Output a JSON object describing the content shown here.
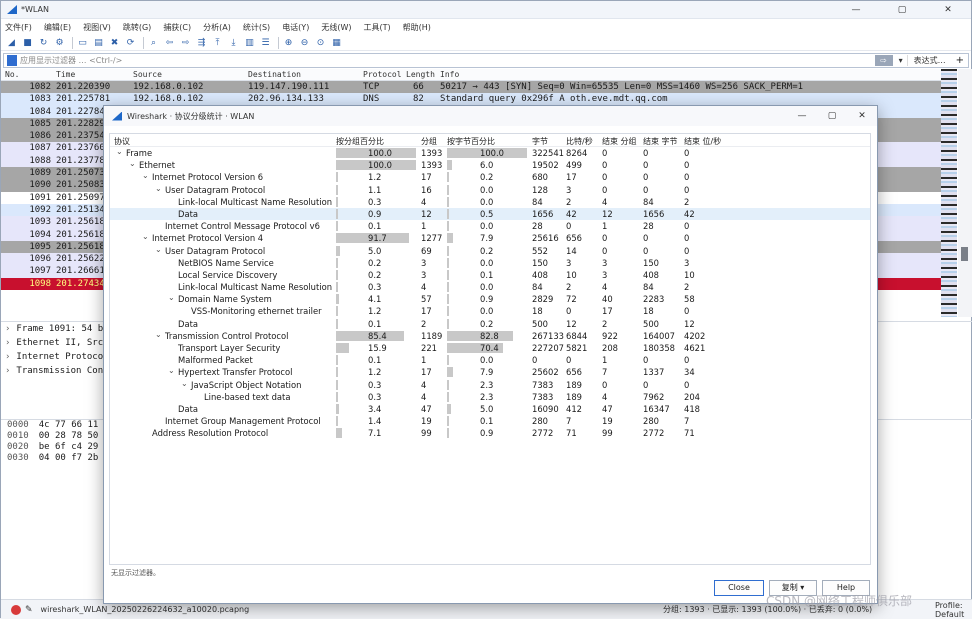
{
  "main": {
    "title": "*WLAN",
    "window_controls": [
      "—",
      "▢",
      "✕"
    ],
    "menu": [
      "文件(F)",
      "编辑(E)",
      "视图(V)",
      "跳转(G)",
      "捕获(C)",
      "分析(A)",
      "统计(S)",
      "电话(Y)",
      "无线(W)",
      "工具(T)",
      "帮助(H)"
    ],
    "filter": {
      "placeholder": "应用显示过滤器 … <Ctrl-/>",
      "arrow": "⇨",
      "dropdown": "▾",
      "expression": "表达式…",
      "plus": "+"
    },
    "columns": [
      "No.",
      "Time",
      "Source",
      "Destination",
      "Protocol",
      "Length",
      "Info"
    ],
    "packets": [
      {
        "no": "1082",
        "time": "201.220390",
        "src": "192.168.0.102",
        "dst": "119.147.190.111",
        "proto": "TCP",
        "len": "66",
        "info": "50217 → 443 [SYN] Seq=0 Win=65535 Len=0 MSS=1460 WS=256 SACK_PERM=1",
        "bg": "#a6a6a6",
        "fg": "#1a1a1a"
      },
      {
        "no": "1083",
        "time": "201.225781",
        "src": "192.168.0.102",
        "dst": "202.96.134.133",
        "proto": "DNS",
        "len": "82",
        "info": "Standard query 0x296f A oth.eve.mdt.qq.com",
        "bg": "#dae8fc",
        "fg": "#1a1a1a"
      },
      {
        "no": "1084",
        "time": "201.22784",
        "src": "",
        "dst": "",
        "proto": "",
        "len": "",
        "info": "",
        "bg": "#dae8fc",
        "fg": "#1a1a1a"
      },
      {
        "no": "1085",
        "time": "201.22829",
        "src": "",
        "dst": "",
        "proto": "",
        "len": "",
        "info": "",
        "bg": "#a6a6a6",
        "fg": "#1a1a1a"
      },
      {
        "no": "1086",
        "time": "201.23754",
        "src": "",
        "dst": "",
        "proto": "",
        "len": "",
        "info": "",
        "bg": "#a6a6a6",
        "fg": "#1a1a1a"
      },
      {
        "no": "1087",
        "time": "201.23760",
        "src": "",
        "dst": "",
        "proto": "",
        "len": "",
        "info": "",
        "bg": "#e6e6fa",
        "fg": "#1a1a1a"
      },
      {
        "no": "1088",
        "time": "201.23778",
        "src": "",
        "dst": "",
        "proto": "",
        "len": "",
        "info": "",
        "bg": "#e6e6fa",
        "fg": "#1a1a1a"
      },
      {
        "no": "1089",
        "time": "201.25073",
        "src": "",
        "dst": "",
        "proto": "",
        "len": "",
        "info": "",
        "bg": "#a6a6a6",
        "fg": "#1a1a1a"
      },
      {
        "no": "1090",
        "time": "201.25083",
        "src": "",
        "dst": "",
        "proto": "",
        "len": "",
        "info": "",
        "bg": "#a6a6a6",
        "fg": "#1a1a1a"
      },
      {
        "no": "1091",
        "time": "201.25097",
        "src": "",
        "dst": "",
        "proto": "",
        "len": "",
        "info": "",
        "bg": "#ffffff",
        "fg": "#1a1a1a"
      },
      {
        "no": "1092",
        "time": "201.25134",
        "src": "",
        "dst": "",
        "proto": "",
        "len": "",
        "info": "",
        "bg": "#dae8fc",
        "fg": "#1a1a1a"
      },
      {
        "no": "1093",
        "time": "201.25618",
        "src": "",
        "dst": "",
        "proto": "",
        "len": "",
        "info": "",
        "bg": "#e6e6fa",
        "fg": "#1a1a1a"
      },
      {
        "no": "1094",
        "time": "201.25618",
        "src": "",
        "dst": "",
        "proto": "",
        "len": "",
        "info": "",
        "bg": "#e6e6fa",
        "fg": "#1a1a1a"
      },
      {
        "no": "1095",
        "time": "201.25618",
        "src": "",
        "dst": "",
        "proto": "",
        "len": "",
        "info": "",
        "bg": "#a6a6a6",
        "fg": "#1a1a1a"
      },
      {
        "no": "1096",
        "time": "201.25622",
        "src": "",
        "dst": "",
        "proto": "",
        "len": "",
        "info": "",
        "bg": "#e6e6fa",
        "fg": "#1a1a1a"
      },
      {
        "no": "1097",
        "time": "201.26661",
        "src": "",
        "dst": "",
        "proto": "",
        "len": "",
        "info": "",
        "bg": "#e6e6fa",
        "fg": "#1a1a1a"
      },
      {
        "no": "1098",
        "time": "201.27434",
        "src": "",
        "dst": "",
        "proto": "",
        "len": "",
        "info": "",
        "bg": "#c8102e",
        "fg": "#ffff80"
      }
    ],
    "details": [
      "Frame 1091: 54 b",
      "Ethernet II, Src",
      "Internet Protoco",
      "Transmission Con"
    ],
    "hex": [
      {
        "off": "0000",
        "bytes": "4c 77 66 11"
      },
      {
        "off": "0010",
        "bytes": "00 28 78 50"
      },
      {
        "off": "0020",
        "bytes": "be 6f c4 29"
      },
      {
        "off": "0030",
        "bytes": "04 00 f7 2b"
      }
    ],
    "status": {
      "file": "wireshark_WLAN_20250226224632_a10020.pcapng",
      "right": "分组: 1393 · 已显示: 1393 (100.0%) · 已丢弃: 0 (0.0%)",
      "profile": "Profile: Default"
    }
  },
  "dialog": {
    "title": "Wireshark · 协议分级统计 · WLAN",
    "window_controls": [
      "—",
      "▢",
      "✕"
    ],
    "columns": [
      "协议",
      "按分组百分比",
      "分组",
      "按字节百分比",
      "字节",
      "比特/秒",
      "结束 分组",
      "结束 字节",
      "结束 位/秒"
    ],
    "rows": [
      {
        "level": 0,
        "exp": "⌄",
        "name": "Frame",
        "pp": "100.0",
        "pkts": "1393",
        "bp": "100.0",
        "bytes": "322541",
        "bps": "8264",
        "ep": "0",
        "eb": "0",
        "ebps": "0",
        "pp_v": 100.0,
        "bp_v": 100.0,
        "sel": false
      },
      {
        "level": 1,
        "exp": "⌄",
        "name": "Ethernet",
        "pp": "100.0",
        "pkts": "1393",
        "bp": "6.0",
        "bytes": "19502",
        "bps": "499",
        "ep": "0",
        "eb": "0",
        "ebps": "0",
        "pp_v": 100.0,
        "bp_v": 6.0,
        "sel": false
      },
      {
        "level": 2,
        "exp": "⌄",
        "name": "Internet Protocol Version 6",
        "pp": "1.2",
        "pkts": "17",
        "bp": "0.2",
        "bytes": "680",
        "bps": "17",
        "ep": "0",
        "eb": "0",
        "ebps": "0",
        "pp_v": 1.2,
        "bp_v": 0.2,
        "sel": false
      },
      {
        "level": 3,
        "exp": "⌄",
        "name": "User Datagram Protocol",
        "pp": "1.1",
        "pkts": "16",
        "bp": "0.0",
        "bytes": "128",
        "bps": "3",
        "ep": "0",
        "eb": "0",
        "ebps": "0",
        "pp_v": 1.1,
        "bp_v": 0.0,
        "sel": false
      },
      {
        "level": 4,
        "exp": "",
        "name": "Link-local Multicast Name Resolution",
        "pp": "0.3",
        "pkts": "4",
        "bp": "0.0",
        "bytes": "84",
        "bps": "2",
        "ep": "4",
        "eb": "84",
        "ebps": "2",
        "pp_v": 0.3,
        "bp_v": 0.0,
        "sel": false
      },
      {
        "level": 4,
        "exp": "",
        "name": "Data",
        "pp": "0.9",
        "pkts": "12",
        "bp": "0.5",
        "bytes": "1656",
        "bps": "42",
        "ep": "12",
        "eb": "1656",
        "ebps": "42",
        "pp_v": 0.9,
        "bp_v": 0.5,
        "sel": true
      },
      {
        "level": 3,
        "exp": "",
        "name": "Internet Control Message Protocol v6",
        "pp": "0.1",
        "pkts": "1",
        "bp": "0.0",
        "bytes": "28",
        "bps": "0",
        "ep": "1",
        "eb": "28",
        "ebps": "0",
        "pp_v": 0.1,
        "bp_v": 0.0,
        "sel": false
      },
      {
        "level": 2,
        "exp": "⌄",
        "name": "Internet Protocol Version 4",
        "pp": "91.7",
        "pkts": "1277",
        "bp": "7.9",
        "bytes": "25616",
        "bps": "656",
        "ep": "0",
        "eb": "0",
        "ebps": "0",
        "pp_v": 91.7,
        "bp_v": 7.9,
        "sel": false
      },
      {
        "level": 3,
        "exp": "⌄",
        "name": "User Datagram Protocol",
        "pp": "5.0",
        "pkts": "69",
        "bp": "0.2",
        "bytes": "552",
        "bps": "14",
        "ep": "0",
        "eb": "0",
        "ebps": "0",
        "pp_v": 5.0,
        "bp_v": 0.2,
        "sel": false
      },
      {
        "level": 4,
        "exp": "",
        "name": "NetBIOS Name Service",
        "pp": "0.2",
        "pkts": "3",
        "bp": "0.0",
        "bytes": "150",
        "bps": "3",
        "ep": "3",
        "eb": "150",
        "ebps": "3",
        "pp_v": 0.2,
        "bp_v": 0.0,
        "sel": false
      },
      {
        "level": 4,
        "exp": "",
        "name": "Local Service Discovery",
        "pp": "0.2",
        "pkts": "3",
        "bp": "0.1",
        "bytes": "408",
        "bps": "10",
        "ep": "3",
        "eb": "408",
        "ebps": "10",
        "pp_v": 0.2,
        "bp_v": 0.1,
        "sel": false
      },
      {
        "level": 4,
        "exp": "",
        "name": "Link-local Multicast Name Resolution",
        "pp": "0.3",
        "pkts": "4",
        "bp": "0.0",
        "bytes": "84",
        "bps": "2",
        "ep": "4",
        "eb": "84",
        "ebps": "2",
        "pp_v": 0.3,
        "bp_v": 0.0,
        "sel": false
      },
      {
        "level": 4,
        "exp": "⌄",
        "name": "Domain Name System",
        "pp": "4.1",
        "pkts": "57",
        "bp": "0.9",
        "bytes": "2829",
        "bps": "72",
        "ep": "40",
        "eb": "2283",
        "ebps": "58",
        "pp_v": 4.1,
        "bp_v": 0.9,
        "sel": false
      },
      {
        "level": 5,
        "exp": "",
        "name": "VSS-Monitoring ethernet trailer",
        "pp": "1.2",
        "pkts": "17",
        "bp": "0.0",
        "bytes": "18",
        "bps": "0",
        "ep": "17",
        "eb": "18",
        "ebps": "0",
        "pp_v": 1.2,
        "bp_v": 0.0,
        "sel": false
      },
      {
        "level": 4,
        "exp": "",
        "name": "Data",
        "pp": "0.1",
        "pkts": "2",
        "bp": "0.2",
        "bytes": "500",
        "bps": "12",
        "ep": "2",
        "eb": "500",
        "ebps": "12",
        "pp_v": 0.1,
        "bp_v": 0.2,
        "sel": false
      },
      {
        "level": 3,
        "exp": "⌄",
        "name": "Transmission Control Protocol",
        "pp": "85.4",
        "pkts": "1189",
        "bp": "82.8",
        "bytes": "267133",
        "bps": "6844",
        "ep": "922",
        "eb": "164007",
        "ebps": "4202",
        "pp_v": 85.4,
        "bp_v": 82.8,
        "sel": false
      },
      {
        "level": 4,
        "exp": "",
        "name": "Transport Layer Security",
        "pp": "15.9",
        "pkts": "221",
        "bp": "70.4",
        "bytes": "227207",
        "bps": "5821",
        "ep": "208",
        "eb": "180358",
        "ebps": "4621",
        "pp_v": 15.9,
        "bp_v": 70.4,
        "sel": false
      },
      {
        "level": 4,
        "exp": "",
        "name": "Malformed Packet",
        "pp": "0.1",
        "pkts": "1",
        "bp": "0.0",
        "bytes": "0",
        "bps": "0",
        "ep": "1",
        "eb": "0",
        "ebps": "0",
        "pp_v": 0.1,
        "bp_v": 0.0,
        "sel": false
      },
      {
        "level": 4,
        "exp": "⌄",
        "name": "Hypertext Transfer Protocol",
        "pp": "1.2",
        "pkts": "17",
        "bp": "7.9",
        "bytes": "25602",
        "bps": "656",
        "ep": "7",
        "eb": "1337",
        "ebps": "34",
        "pp_v": 1.2,
        "bp_v": 7.9,
        "sel": false
      },
      {
        "level": 5,
        "exp": "⌄",
        "name": "JavaScript Object Notation",
        "pp": "0.3",
        "pkts": "4",
        "bp": "2.3",
        "bytes": "7383",
        "bps": "189",
        "ep": "0",
        "eb": "0",
        "ebps": "0",
        "pp_v": 0.3,
        "bp_v": 2.3,
        "sel": false
      },
      {
        "level": 6,
        "exp": "",
        "name": "Line-based text data",
        "pp": "0.3",
        "pkts": "4",
        "bp": "2.3",
        "bytes": "7383",
        "bps": "189",
        "ep": "4",
        "eb": "7962",
        "ebps": "204",
        "pp_v": 0.3,
        "bp_v": 2.3,
        "sel": false
      },
      {
        "level": 4,
        "exp": "",
        "name": "Data",
        "pp": "3.4",
        "pkts": "47",
        "bp": "5.0",
        "bytes": "16090",
        "bps": "412",
        "ep": "47",
        "eb": "16347",
        "ebps": "418",
        "pp_v": 3.4,
        "bp_v": 5.0,
        "sel": false
      },
      {
        "level": 3,
        "exp": "",
        "name": "Internet Group Management Protocol",
        "pp": "1.4",
        "pkts": "19",
        "bp": "0.1",
        "bytes": "280",
        "bps": "7",
        "ep": "19",
        "eb": "280",
        "ebps": "7",
        "pp_v": 1.4,
        "bp_v": 0.1,
        "sel": false
      },
      {
        "level": 2,
        "exp": "",
        "name": "Address Resolution Protocol",
        "pp": "7.1",
        "pkts": "99",
        "bp": "0.9",
        "bytes": "2772",
        "bps": "71",
        "ep": "99",
        "eb": "2772",
        "ebps": "71",
        "pp_v": 7.1,
        "bp_v": 0.9,
        "sel": false
      }
    ],
    "footer_label": "无显示过滤器。",
    "buttons": {
      "close": "Close",
      "copy": "复制",
      "copy_arrow": "▾",
      "help": "Help"
    }
  },
  "watermark": "CSDN @网络工程师俱乐部"
}
